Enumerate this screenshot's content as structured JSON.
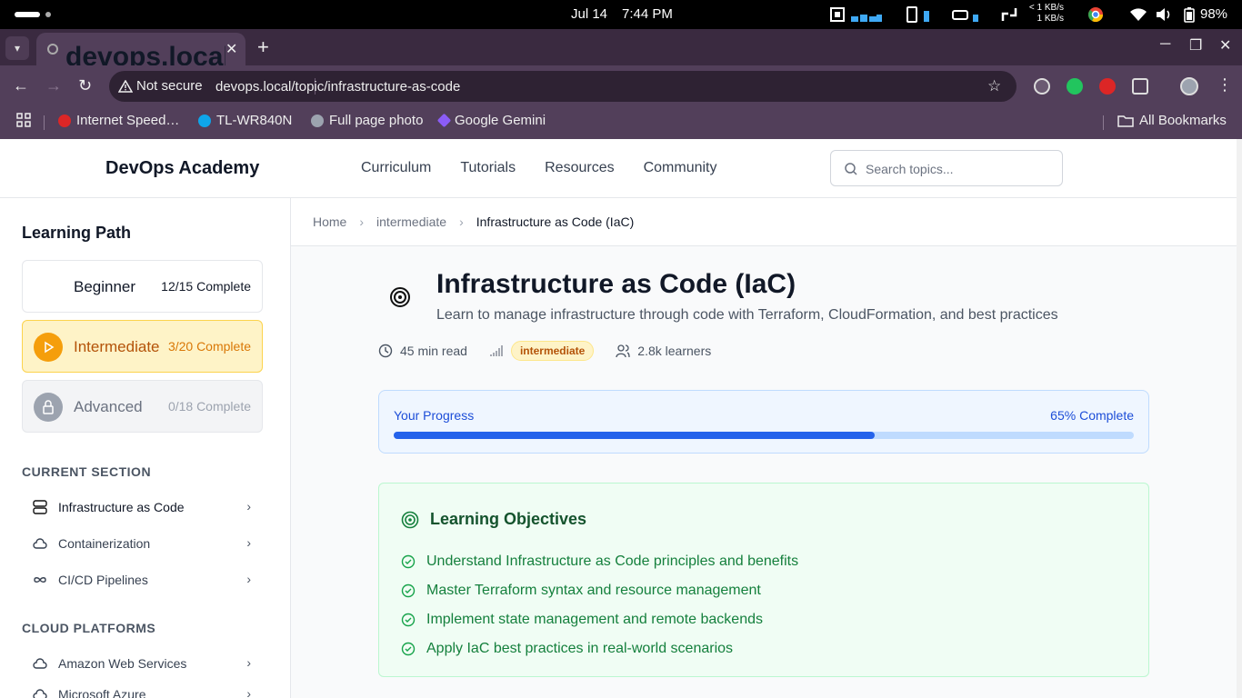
{
  "os": {
    "date": "Jul 14",
    "time": "7:44 PM",
    "net_up": "< 1 KB/s",
    "net_down": "1 KB/s",
    "battery": "98%"
  },
  "browser": {
    "tab_title": "devops.local/topic/infrastructure-as-code",
    "security_label": "Not secure",
    "url": "devops.local/topic/infrastructure-as-code",
    "bookmarks": [
      "Internet Speed…",
      "TL-WR840N",
      "Full page photo",
      "Google Gemini"
    ],
    "all_bookmarks": "All Bookmarks"
  },
  "site": {
    "brand": "DevOps Academy",
    "nav": [
      "Curriculum",
      "Tutorials",
      "Resources",
      "Community"
    ],
    "search_placeholder": "Search topics..."
  },
  "sidebar": {
    "heading": "Learning Path",
    "levels": [
      {
        "name": "Beginner",
        "progress": "12/15 Complete"
      },
      {
        "name": "Intermediate",
        "progress": "3/20 Complete"
      },
      {
        "name": "Advanced",
        "progress": "0/18 Complete"
      }
    ],
    "current_section_heading": "CURRENT SECTION",
    "current_section": [
      "Infrastructure as Code",
      "Containerization",
      "CI/CD Pipelines"
    ],
    "cloud_heading": "CLOUD PLATFORMS",
    "cloud": [
      "Amazon Web Services",
      "Microsoft Azure"
    ]
  },
  "breadcrumb": [
    "Home",
    "intermediate",
    "Infrastructure as Code (IaC)"
  ],
  "topic": {
    "title": "Infrastructure as Code (IaC)",
    "subtitle": "Learn to manage infrastructure through code with Terraform, CloudFormation, and best practices",
    "read_time": "45 min read",
    "level_badge": "intermediate",
    "learners": "2.8k learners"
  },
  "progress": {
    "label": "Your Progress",
    "value_text": "65% Complete",
    "fraction": 0.65
  },
  "objectives": {
    "heading": "Learning Objectives",
    "items": [
      "Understand Infrastructure as Code principles and benefits",
      "Master Terraform syntax and resource management",
      "Implement state management and remote backends",
      "Apply IaC best practices in real-world scenarios"
    ]
  },
  "colors": {
    "accent_blue": "#2563eb",
    "intermediate_amber": "#f59e0b",
    "objective_green": "#15803d"
  }
}
